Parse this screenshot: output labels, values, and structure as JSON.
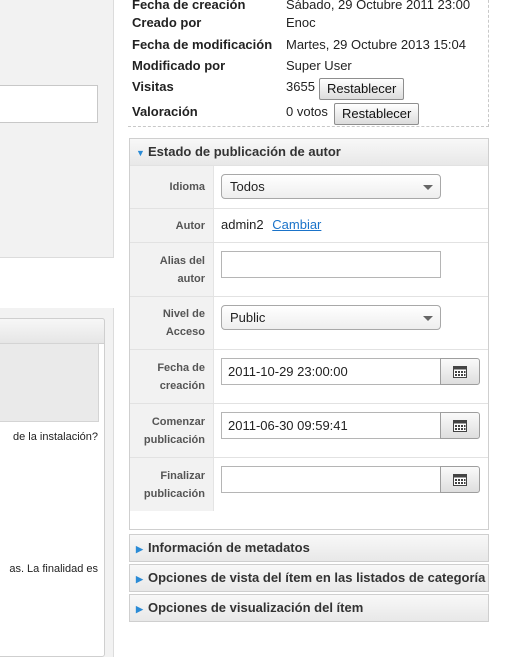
{
  "left": {
    "text_1": "de la instalación?",
    "text_2": "as. La finalidad es"
  },
  "info": {
    "rows": [
      {
        "label": "Fecha de creación",
        "value": "Sábado, 29 Octubre 2011 23:00"
      },
      {
        "label": "Creado por",
        "value": "Enoc"
      },
      {
        "label": "Fecha de modificación",
        "value": "Martes, 29 Octubre 2013 15:04"
      },
      {
        "label": "Modificado por",
        "value": "Super User"
      },
      {
        "label": "Visitas",
        "value": "3655"
      },
      {
        "label": "Valoración",
        "value": "0 votos"
      }
    ],
    "reset_label": "Restablecer"
  },
  "author_panel": {
    "title": "Estado de publicación de autor",
    "idioma_label": "Idioma",
    "idioma_value": "Todos",
    "autor_label": "Autor",
    "autor_value": "admin2",
    "cambiar_label": "Cambiar",
    "alias_label": "Alias del autor",
    "alias_value": "",
    "nivel_label": "Nivel de Acceso",
    "nivel_value": "Public",
    "fecha_creacion_label": "Fecha de creación",
    "fecha_creacion_value": "2011-10-29 23:00:00",
    "comenzar_label": "Comenzar publicación",
    "comenzar_value": "2011-06-30 09:59:41",
    "finalizar_label": "Finalizar publicación",
    "finalizar_value": ""
  },
  "collapsed_panels": [
    {
      "title": "Información de metadatos"
    },
    {
      "title": "Opciones de vista del ítem en las listados de categoría"
    },
    {
      "title": "Opciones de visualización del ítem"
    }
  ],
  "icons": {
    "expanded": "triangle-down-icon",
    "collapsed": "triangle-right-icon",
    "calendar": "calendar-icon"
  },
  "colors": {
    "accent": "#2a8bd6",
    "link": "#1a73c9"
  }
}
